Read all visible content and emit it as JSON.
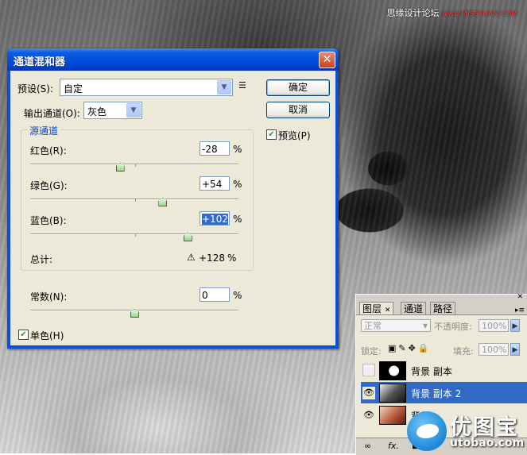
{
  "watermark_top": "思缘设计论坛",
  "watermark_top_site": "www.MISSYUAN.COM",
  "dialog": {
    "title": "通道混和器",
    "preset_label": "预设(S):",
    "preset_value": "自定",
    "output_label": "输出通道(O):",
    "output_value": "灰色",
    "ok_label": "确定",
    "cancel_label": "取消",
    "preview_label": "预览(P)",
    "preview_checked": true,
    "source_group_label": "源通道",
    "red_label": "红色(R):",
    "red_value": "-28",
    "red_level": -28,
    "green_label": "绿色(G):",
    "green_value": "+54",
    "green_level": 54,
    "blue_label": "蓝色(B):",
    "blue_value": "+102",
    "blue_level": 102,
    "total_label": "总计:",
    "total_value": "+128",
    "constant_label": "常数(N):",
    "constant_value": "0",
    "constant_level": 0,
    "percent": "%",
    "mono_label": "单色(H)",
    "mono_checked": true
  },
  "layers_panel": {
    "tabs": [
      "图层",
      "通道",
      "路径"
    ],
    "blend_mode": "正常",
    "opacity_label": "不透明度:",
    "opacity_value": "100%",
    "lock_label": "锁定:",
    "fill_label": "填充:",
    "fill_value": "100%",
    "layers": [
      {
        "name": "背景 副本",
        "visible": false
      },
      {
        "name": "背景 副本 2",
        "visible": true,
        "selected": true
      },
      {
        "name": "背景",
        "visible": true
      }
    ],
    "fx_label": "fx."
  },
  "logo": {
    "cn": "优图宝",
    "en": "utobao.com"
  },
  "colors": {
    "title_bar": "#0a4fd8",
    "selection": "#316ac5",
    "dialog_bg": "#ece9d8"
  }
}
